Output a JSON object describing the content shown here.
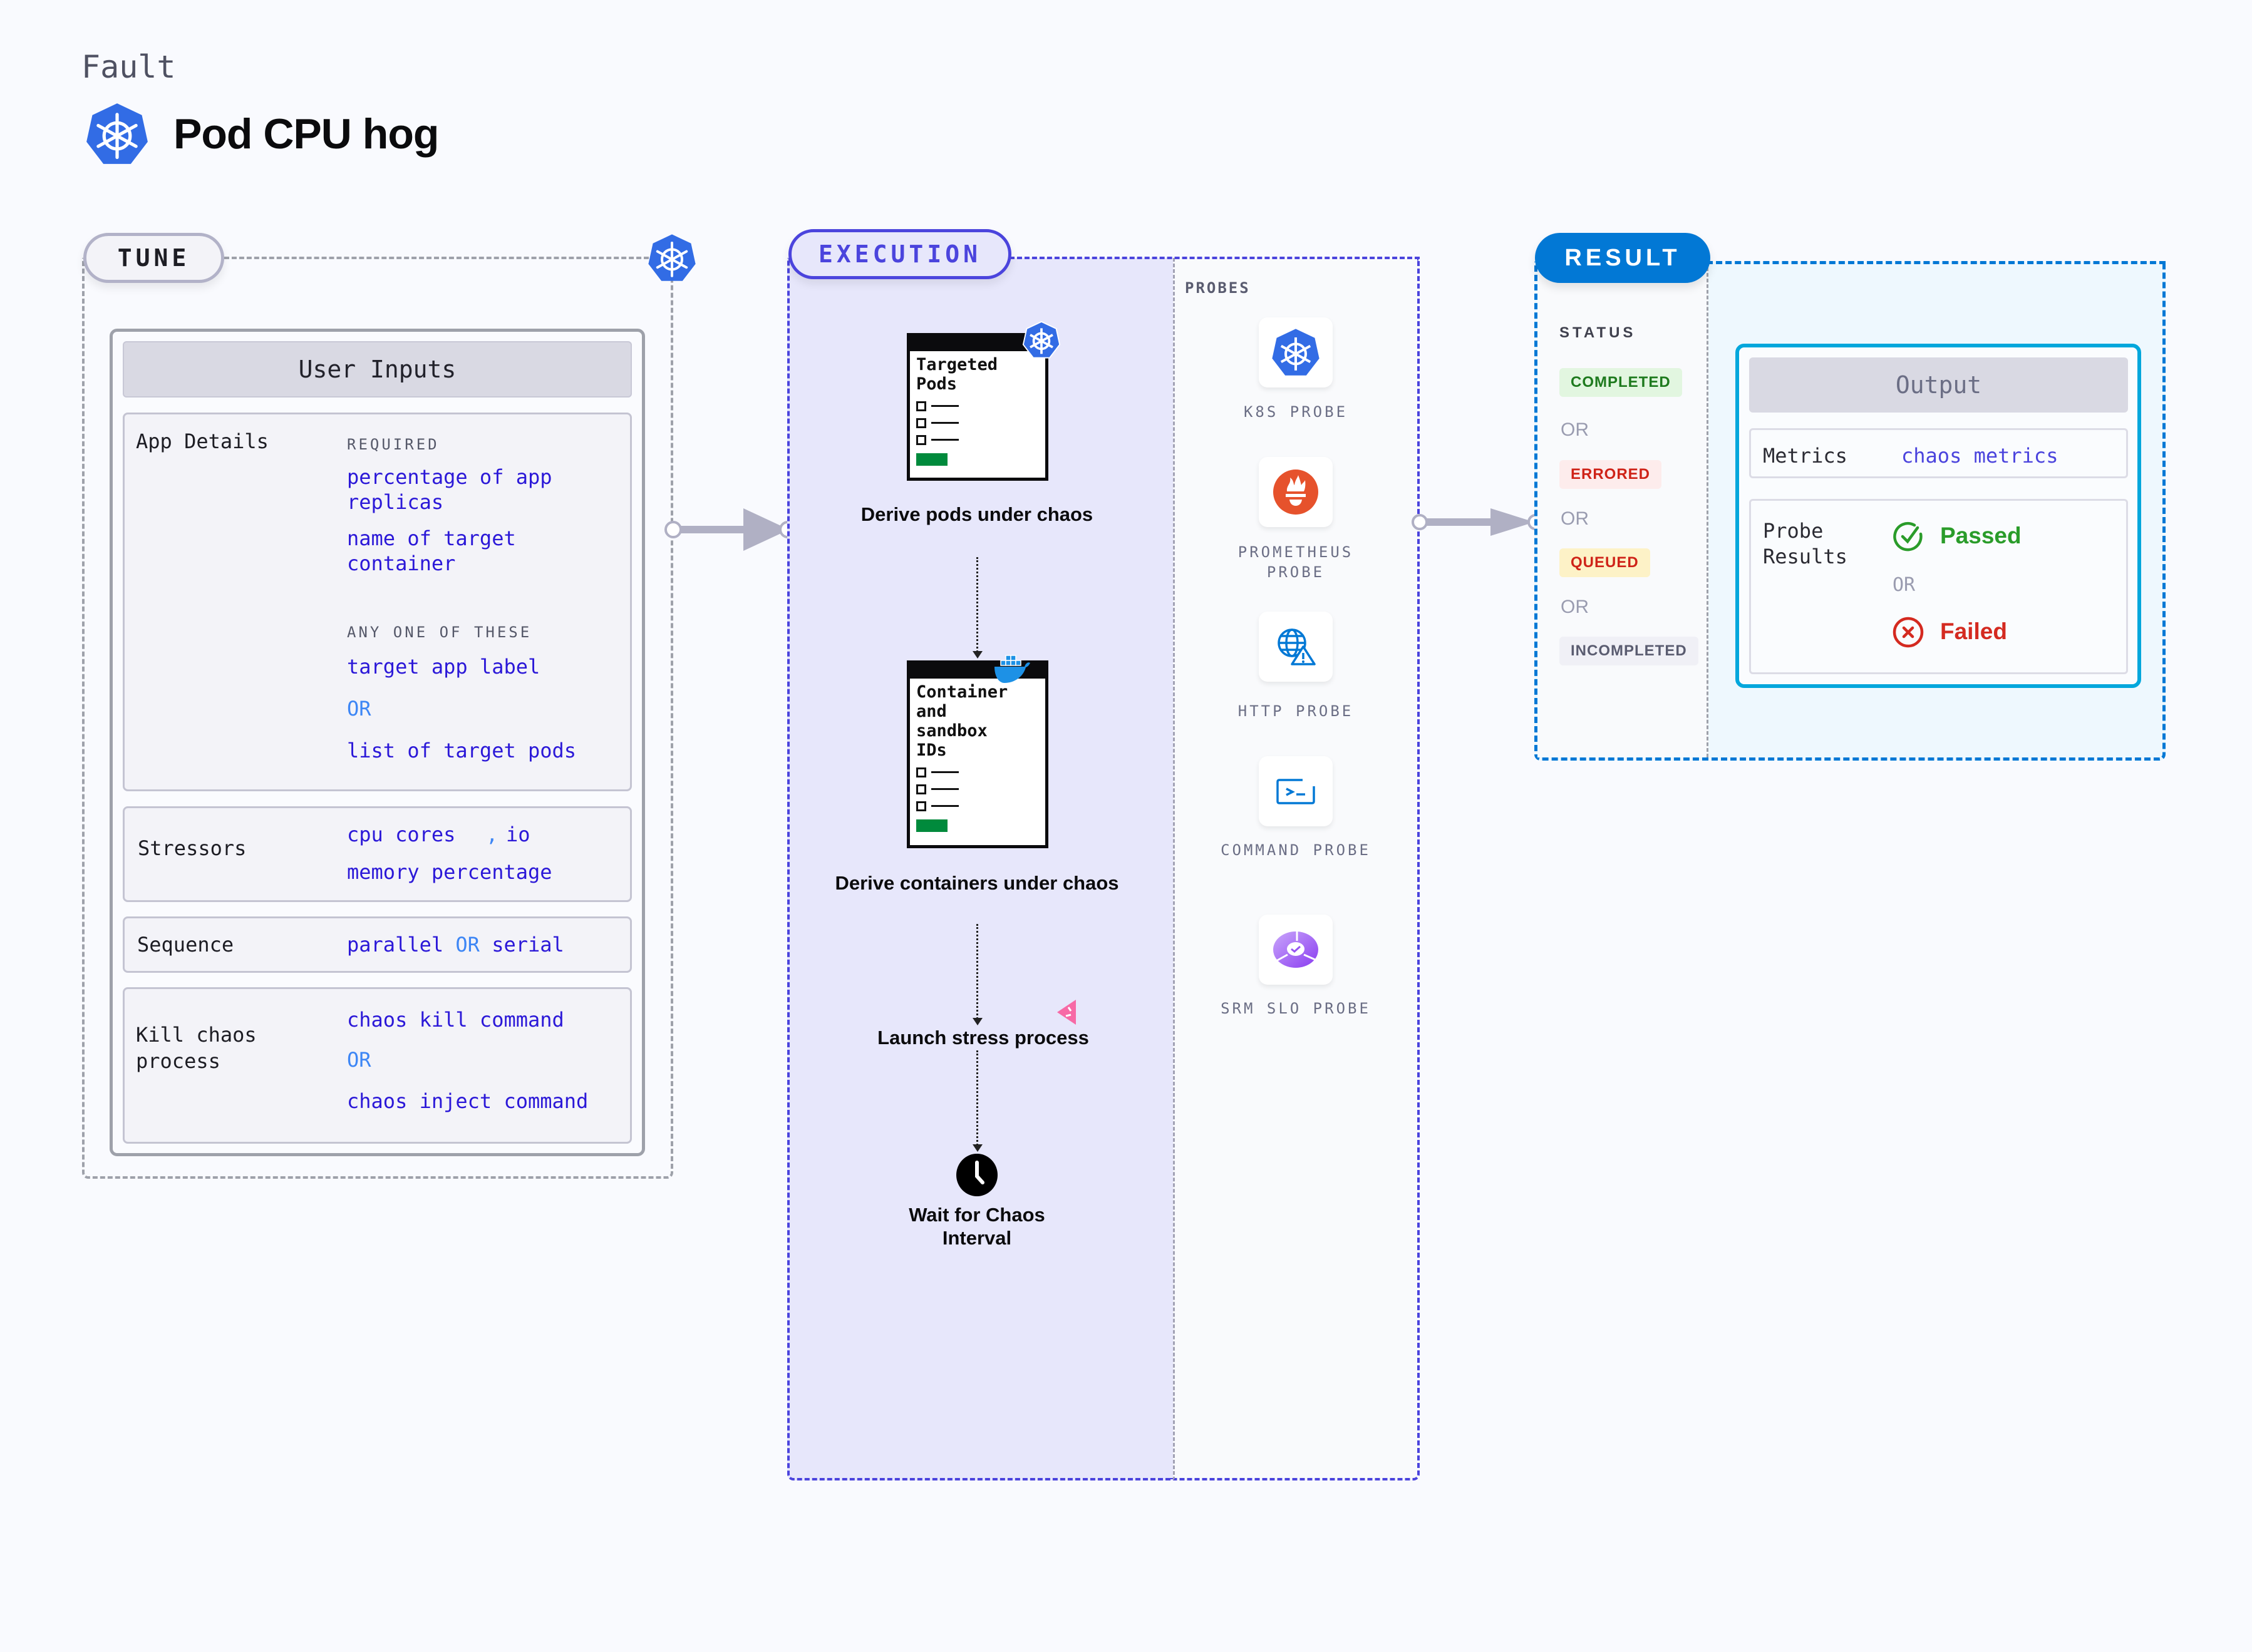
{
  "header": {
    "kicker": "Fault",
    "title": "Pod CPU hog",
    "icon": "kubernetes-icon"
  },
  "tune": {
    "pill_label": "TUNE",
    "corner_icon": "kubernetes-icon",
    "user_inputs": {
      "title": "User Inputs",
      "app_details": {
        "label": "App Details",
        "required_hint": "REQUIRED",
        "required": [
          "percentage of app replicas",
          "name of target container"
        ],
        "any_one_hint": "ANY ONE OF THESE",
        "any_one": [
          "target app label",
          "list of target pods"
        ],
        "or_label": "OR"
      },
      "stressors": {
        "label": "Stressors",
        "line1_a": "cpu cores",
        "line1_sep": ",",
        "line1_b": "io",
        "line2": "memory percentage"
      },
      "sequence": {
        "label": "Sequence",
        "a": "parallel",
        "or_label": "OR",
        "b": "serial"
      },
      "kill_chaos": {
        "label": "Kill chaos process",
        "a": "chaos kill command",
        "or_label": "OR",
        "b": "chaos inject command"
      }
    }
  },
  "execution": {
    "pill_label": "EXECUTION",
    "steps": [
      {
        "card_title": "Targeted Pods",
        "badge_icon": "kubernetes-icon",
        "label": "Derive pods under chaos"
      },
      {
        "card_title": "Container and sandbox IDs",
        "badge_icon": "docker-icon",
        "label": "Derive containers under chaos"
      },
      {
        "label": "Launch stress process",
        "badge_icon": "stress-icon"
      },
      {
        "label": "Wait for Chaos Interval",
        "icon": "clock-icon"
      }
    ],
    "probes": {
      "title": "PROBES",
      "items": [
        {
          "label": "K8S PROBE",
          "icon": "kubernetes-icon"
        },
        {
          "label": "PROMETHEUS PROBE",
          "icon": "prometheus-icon"
        },
        {
          "label": "HTTP PROBE",
          "icon": "http-globe-warning-icon"
        },
        {
          "label": "COMMAND PROBE",
          "icon": "terminal-icon"
        },
        {
          "label": "SRM SLO PROBE",
          "icon": "slo-icon"
        }
      ]
    }
  },
  "result": {
    "pill_label": "RESULT",
    "status": {
      "title": "STATUS",
      "or_label": "OR",
      "badges": [
        {
          "label": "COMPLETED",
          "color": "#1e7a1e",
          "bg": "#e2f6e0"
        },
        {
          "label": "ERRORED",
          "color": "#cf2318",
          "bg": "#fdecec"
        },
        {
          "label": "QUEUED",
          "color": "#cf2318",
          "bg": "#fdf2c7"
        },
        {
          "label": "INCOMPLETED",
          "color": "#5a5c70",
          "bg": "#f0f0f6"
        }
      ]
    },
    "output": {
      "title": "Output",
      "metrics_label": "Metrics",
      "metrics_value": "chaos metrics",
      "probe_results_label": "Probe Results",
      "passed": "Passed",
      "or_label": "OR",
      "failed": "Failed"
    }
  },
  "colors": {
    "execution_accent": "#4b44dd",
    "result_accent": "#0278d5",
    "value_text": "#2b18d8",
    "or_text": "#3d86f5",
    "passed": "#2a9c2a",
    "failed": "#d42a20"
  }
}
